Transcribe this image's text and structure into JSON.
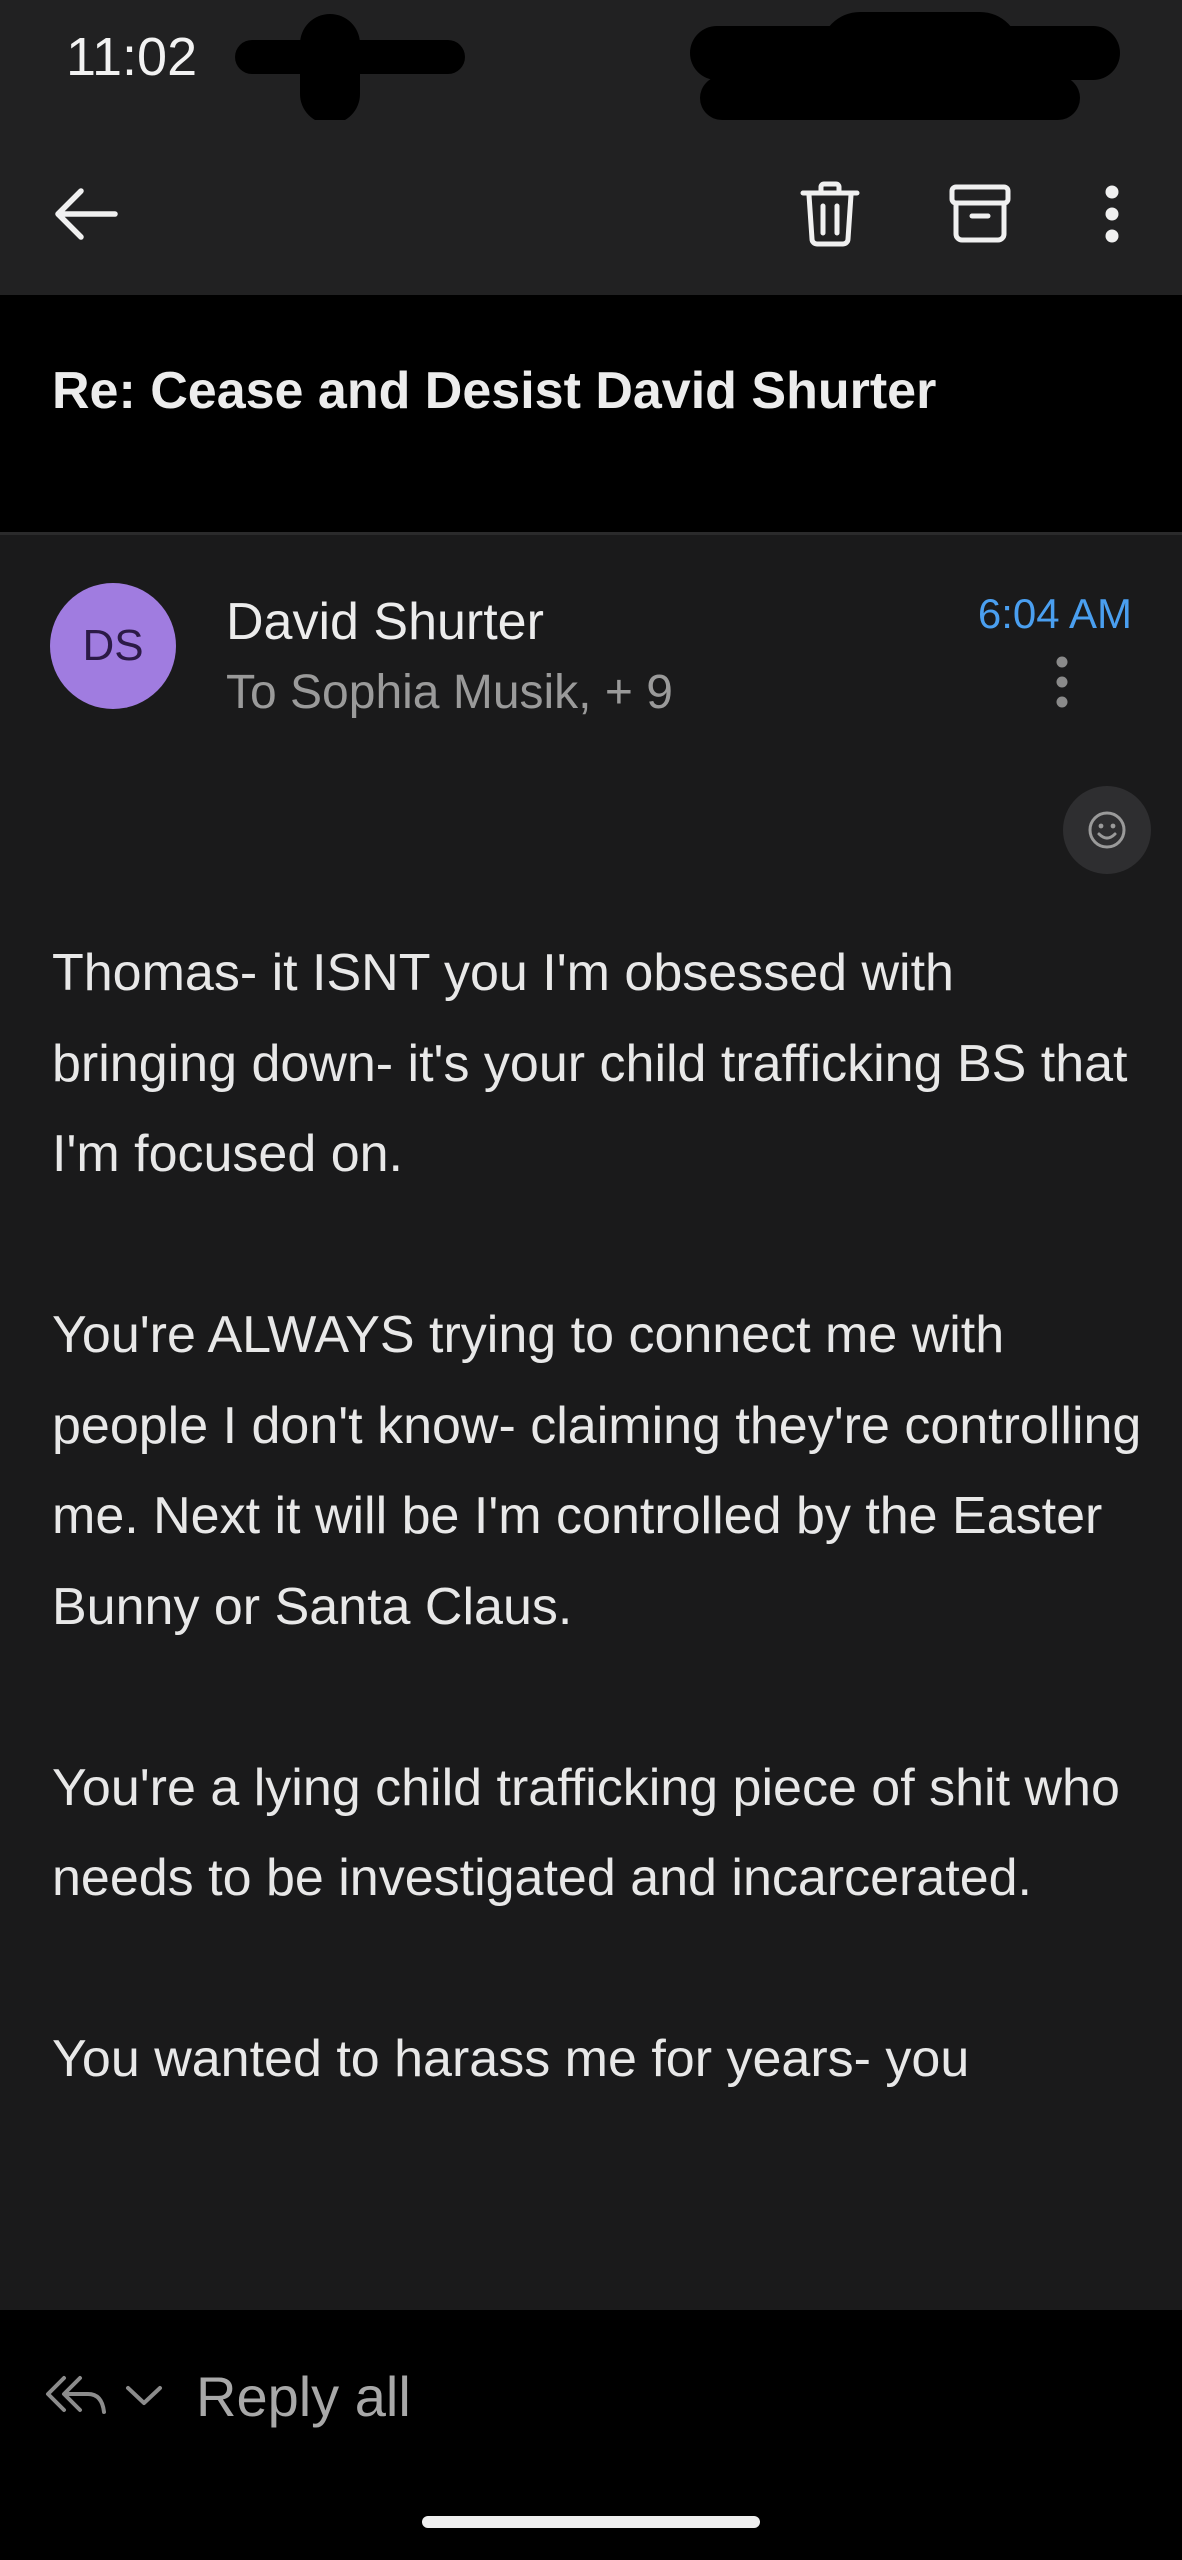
{
  "status_bar": {
    "time": "11:02"
  },
  "app_bar": {
    "back_icon": "arrow-left-icon",
    "delete_icon": "trash-icon",
    "archive_icon": "archive-icon",
    "more_icon": "more-vert-icon"
  },
  "email": {
    "subject": "Re: Cease and Desist David Shurter",
    "avatar_initials": "DS",
    "avatar_color": "#a07ce0",
    "sender": "David Shurter",
    "recipients": "To Sophia Musik, + 9",
    "time": "6:04 AM",
    "time_color": "#4a9ff0",
    "body": [
      "Thomas- it ISNT you I'm obsessed with bringing down- it's your child trafficking BS that I'm focused on.",
      "You're ALWAYS trying to connect me with people I don't know- claiming they're controlling me. Next it will be I'm controlled by the Easter Bunny or Santa Claus.",
      "You're a lying child trafficking piece of shit who needs to be investigated and incarcerated.",
      "You wanted to harass me for years- you"
    ]
  },
  "bottom_bar": {
    "reply_label": "Reply all",
    "reply_icon": "reply-all-icon"
  }
}
